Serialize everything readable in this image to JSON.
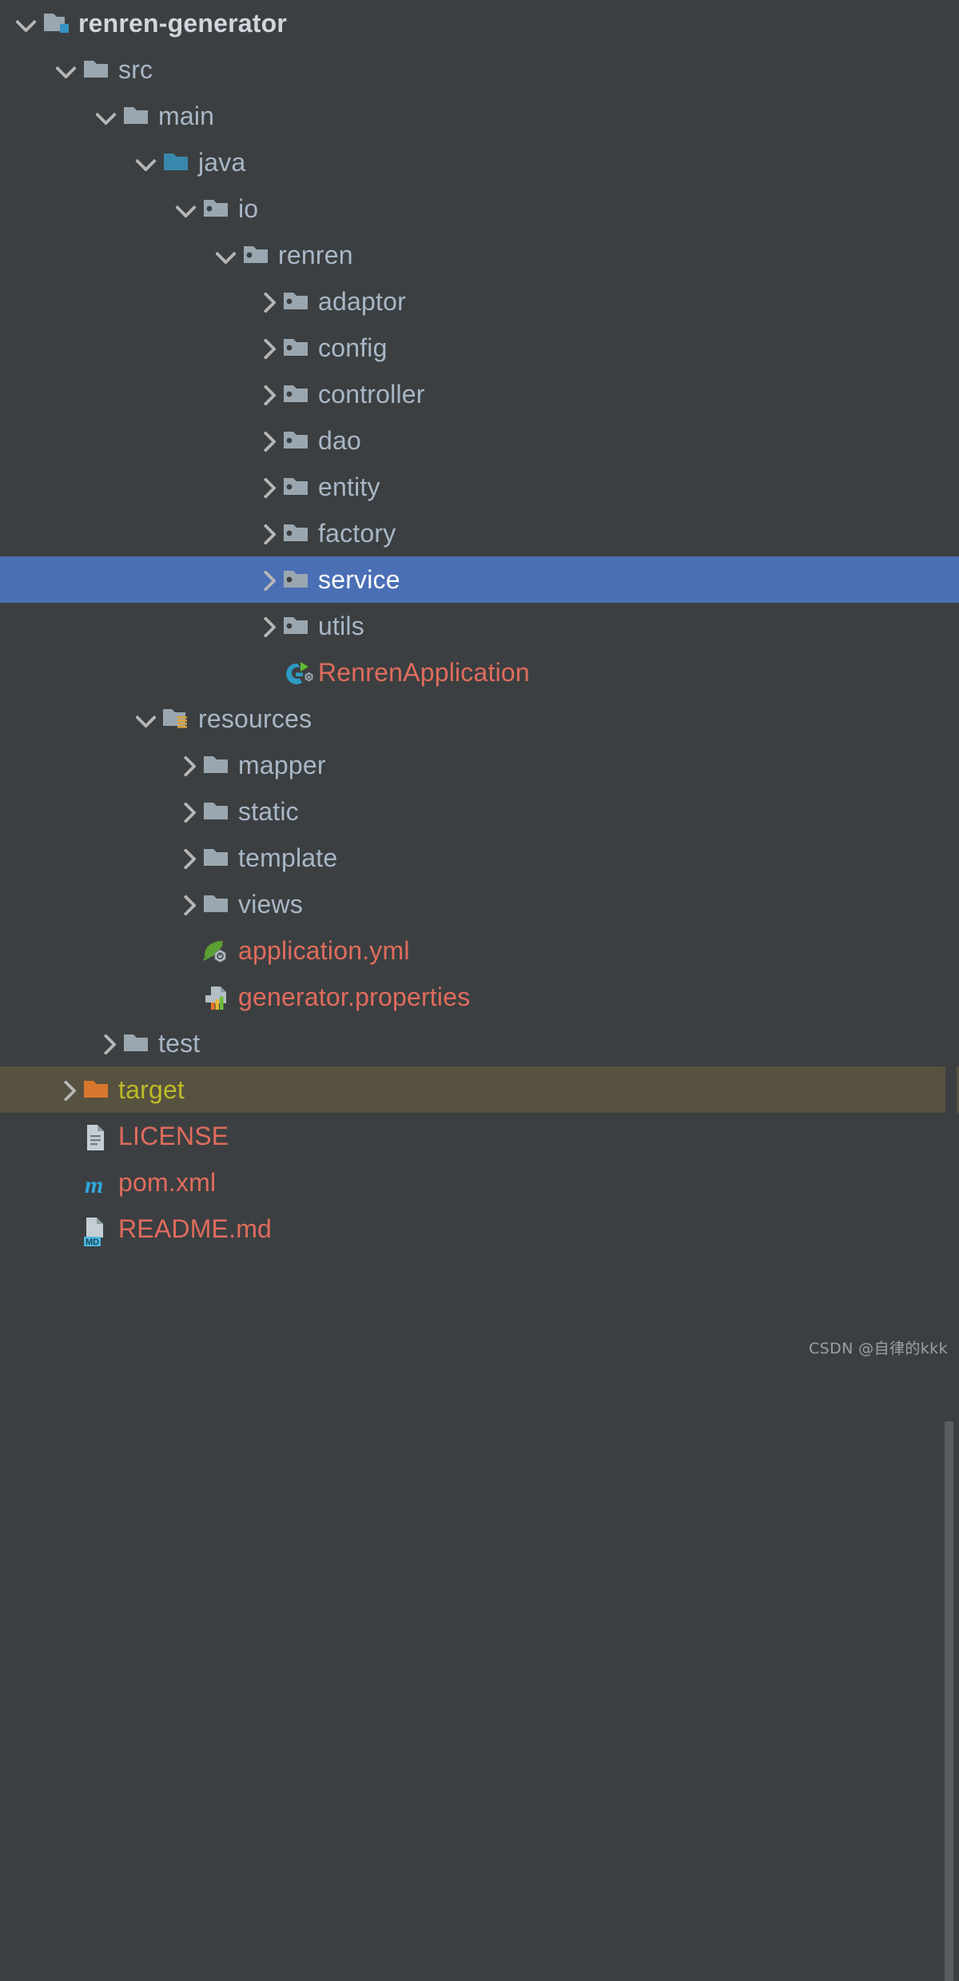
{
  "theme": {
    "background": "#3c3f41",
    "selection_blue": "#4a6fb5",
    "target_highlight": "#57513f",
    "folder_text": "#a9b7c6",
    "file_text": "#e06c5d",
    "target_text": "#bcbc28",
    "root_text": "#cfd6dd",
    "arrow_color": "#b6b6b6",
    "scrollbar_thumb": "#5a5d5f"
  },
  "tree": {
    "nodes": [
      {
        "label": "renren-generator",
        "icon": "module-folder-icon",
        "depth": 1,
        "arrow": "down",
        "kind": "root",
        "state": "normal"
      },
      {
        "label": "src",
        "icon": "folder-icon",
        "depth": 2,
        "arrow": "down",
        "kind": "dir",
        "state": "normal"
      },
      {
        "label": "main",
        "icon": "folder-icon",
        "depth": 3,
        "arrow": "down",
        "kind": "dir",
        "state": "normal"
      },
      {
        "label": "java",
        "icon": "source-root-folder-icon",
        "depth": 4,
        "arrow": "down",
        "kind": "dir",
        "state": "normal"
      },
      {
        "label": "io",
        "icon": "package-icon",
        "depth": 5,
        "arrow": "down",
        "kind": "dir",
        "state": "normal"
      },
      {
        "label": "renren",
        "icon": "package-icon",
        "depth": 6,
        "arrow": "down",
        "kind": "dir",
        "state": "normal"
      },
      {
        "label": "adaptor",
        "icon": "package-icon",
        "depth": 7,
        "arrow": "right",
        "kind": "dir",
        "state": "normal"
      },
      {
        "label": "config",
        "icon": "package-icon",
        "depth": 7,
        "arrow": "right",
        "kind": "dir",
        "state": "normal"
      },
      {
        "label": "controller",
        "icon": "package-icon",
        "depth": 7,
        "arrow": "right",
        "kind": "dir",
        "state": "normal"
      },
      {
        "label": "dao",
        "icon": "package-icon",
        "depth": 7,
        "arrow": "right",
        "kind": "dir",
        "state": "normal"
      },
      {
        "label": "entity",
        "icon": "package-icon",
        "depth": 7,
        "arrow": "right",
        "kind": "dir",
        "state": "normal"
      },
      {
        "label": "factory",
        "icon": "package-icon",
        "depth": 7,
        "arrow": "right",
        "kind": "dir",
        "state": "normal"
      },
      {
        "label": "service",
        "icon": "package-icon",
        "depth": 7,
        "arrow": "right",
        "kind": "dir",
        "state": "selected"
      },
      {
        "label": "utils",
        "icon": "package-icon",
        "depth": 7,
        "arrow": "right",
        "kind": "dir",
        "state": "normal"
      },
      {
        "label": "RenrenApplication",
        "icon": "spring-boot-run-icon",
        "depth": 7,
        "arrow": "none",
        "kind": "file",
        "state": "normal"
      },
      {
        "label": "resources",
        "icon": "resources-root-folder-icon",
        "depth": 4,
        "arrow": "down",
        "kind": "dir",
        "state": "normal"
      },
      {
        "label": "mapper",
        "icon": "folder-icon",
        "depth": 5,
        "arrow": "right",
        "kind": "dir",
        "state": "normal"
      },
      {
        "label": "static",
        "icon": "folder-icon",
        "depth": 5,
        "arrow": "right",
        "kind": "dir",
        "state": "normal"
      },
      {
        "label": "template",
        "icon": "folder-icon",
        "depth": 5,
        "arrow": "right",
        "kind": "dir",
        "state": "normal"
      },
      {
        "label": "views",
        "icon": "folder-icon",
        "depth": 5,
        "arrow": "right",
        "kind": "dir",
        "state": "normal"
      },
      {
        "label": "application.yml",
        "icon": "spring-config-leaf-icon",
        "depth": 5,
        "arrow": "none",
        "kind": "file",
        "state": "normal"
      },
      {
        "label": "generator.properties",
        "icon": "properties-file-icon",
        "depth": 5,
        "arrow": "none",
        "kind": "file",
        "state": "normal"
      },
      {
        "label": "test",
        "icon": "folder-icon",
        "depth": 3,
        "arrow": "right",
        "kind": "dir",
        "state": "normal"
      },
      {
        "label": "target",
        "icon": "excluded-folder-icon",
        "depth": 2,
        "arrow": "right",
        "kind": "dir",
        "state": "target"
      },
      {
        "label": "LICENSE",
        "icon": "text-file-icon",
        "depth": 2,
        "arrow": "none",
        "kind": "file",
        "state": "normal"
      },
      {
        "label": "pom.xml",
        "icon": "maven-file-icon",
        "depth": 2,
        "arrow": "none",
        "kind": "file",
        "state": "normal"
      },
      {
        "label": "README.md",
        "icon": "markdown-file-icon",
        "depth": 2,
        "arrow": "none",
        "kind": "file",
        "state": "normal"
      }
    ]
  },
  "watermark": {
    "text": "CSDN @自律的kkk"
  }
}
